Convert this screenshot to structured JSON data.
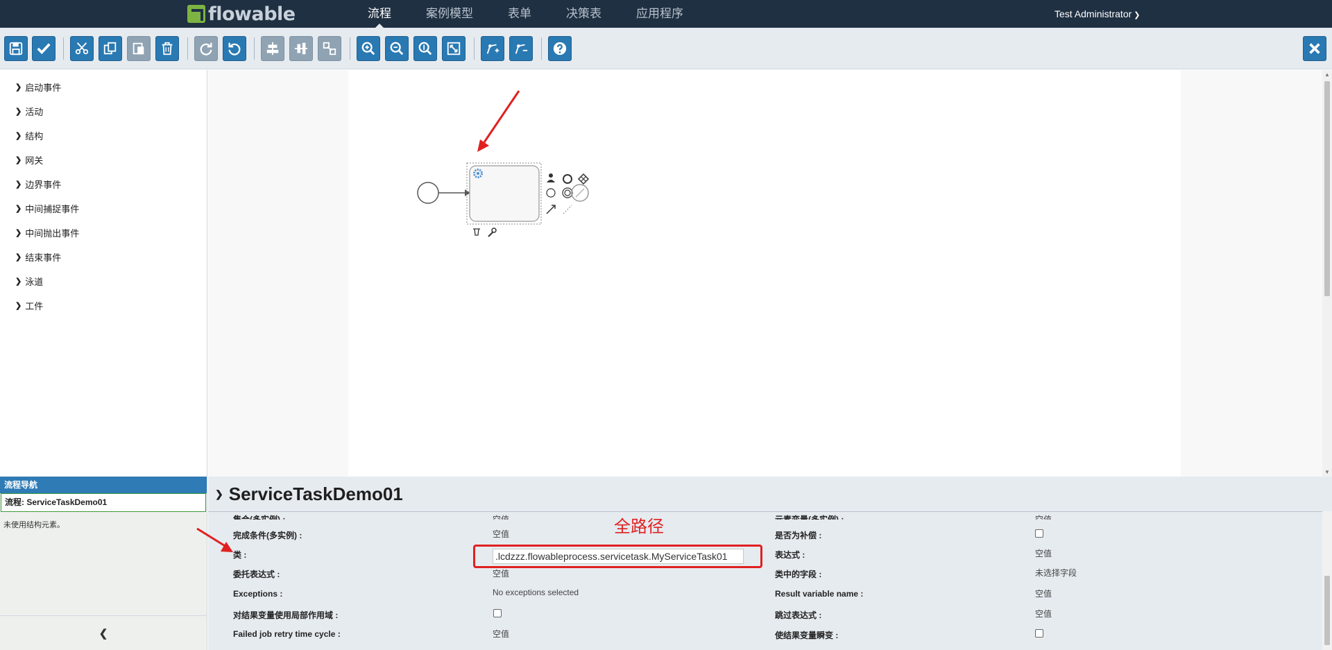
{
  "navbar": {
    "logo_text": "flowable",
    "tabs": [
      {
        "label": "流程"
      },
      {
        "label": "案例模型"
      },
      {
        "label": "表单"
      },
      {
        "label": "决策表"
      },
      {
        "label": "应用程序"
      }
    ],
    "active_tab": "流程",
    "user": "Test Administrator"
  },
  "toolbar": {
    "icons": [
      "save-icon",
      "check-icon",
      "cut-icon",
      "copy-icon",
      "paste-icon",
      "delete-icon",
      "redo-icon",
      "undo-icon",
      "align-horizontal-icon",
      "align-vertical-icon",
      "same-size-icon",
      "zoom-in-icon",
      "zoom-out-icon",
      "zoom-actual-icon",
      "zoom-fit-icon",
      "bend-point-add-icon",
      "bend-point-remove-icon",
      "help-icon",
      "close-icon"
    ]
  },
  "palette": {
    "groups": [
      {
        "label": "启动事件"
      },
      {
        "label": "活动"
      },
      {
        "label": "结构"
      },
      {
        "label": "网关"
      },
      {
        "label": "边界事件"
      },
      {
        "label": "中间捕捉事件"
      },
      {
        "label": "中间抛出事件"
      },
      {
        "label": "结束事件"
      },
      {
        "label": "泳道"
      },
      {
        "label": "工件"
      }
    ]
  },
  "navigation": {
    "title": "流程导航",
    "process": "流程: ServiceTaskDemo01",
    "empty_text": "未使用结构元素。"
  },
  "properties": {
    "title": "ServiceTaskDemo01",
    "annotation": "全路径",
    "left": [
      {
        "label": "集合(多实例) :",
        "value": "空值"
      },
      {
        "label": "完成条件(多实例) :",
        "value": "空值"
      },
      {
        "label": "类 :",
        "value": ".lcdzzz.flowableprocess.servicetask.MyServiceTask01"
      },
      {
        "label": "委托表达式 :",
        "value": "空值"
      },
      {
        "label": "Exceptions :",
        "value": "No exceptions selected"
      },
      {
        "label": "对结果变量使用局部作用域 :",
        "value": ""
      },
      {
        "label": "Failed job retry time cycle :",
        "value": "空值"
      }
    ],
    "right": [
      {
        "label": "元素变量(多实例) :",
        "value": "空值"
      },
      {
        "label": "是否为补偿 :",
        "value": ""
      },
      {
        "label": "表达式 :",
        "value": "空值"
      },
      {
        "label": "类中的字段 :",
        "value": "未选择字段"
      },
      {
        "label": "Result variable name :",
        "value": "空值"
      },
      {
        "label": "跳过表达式 :",
        "value": "空值"
      },
      {
        "label": "使结果变量瞬变 :",
        "value": ""
      }
    ]
  },
  "colors": {
    "navbar_bg": "#1f3042",
    "toolbar_button": "#2979b3",
    "annotation_red": "#e02020",
    "nav_head": "#2e7bb5"
  }
}
